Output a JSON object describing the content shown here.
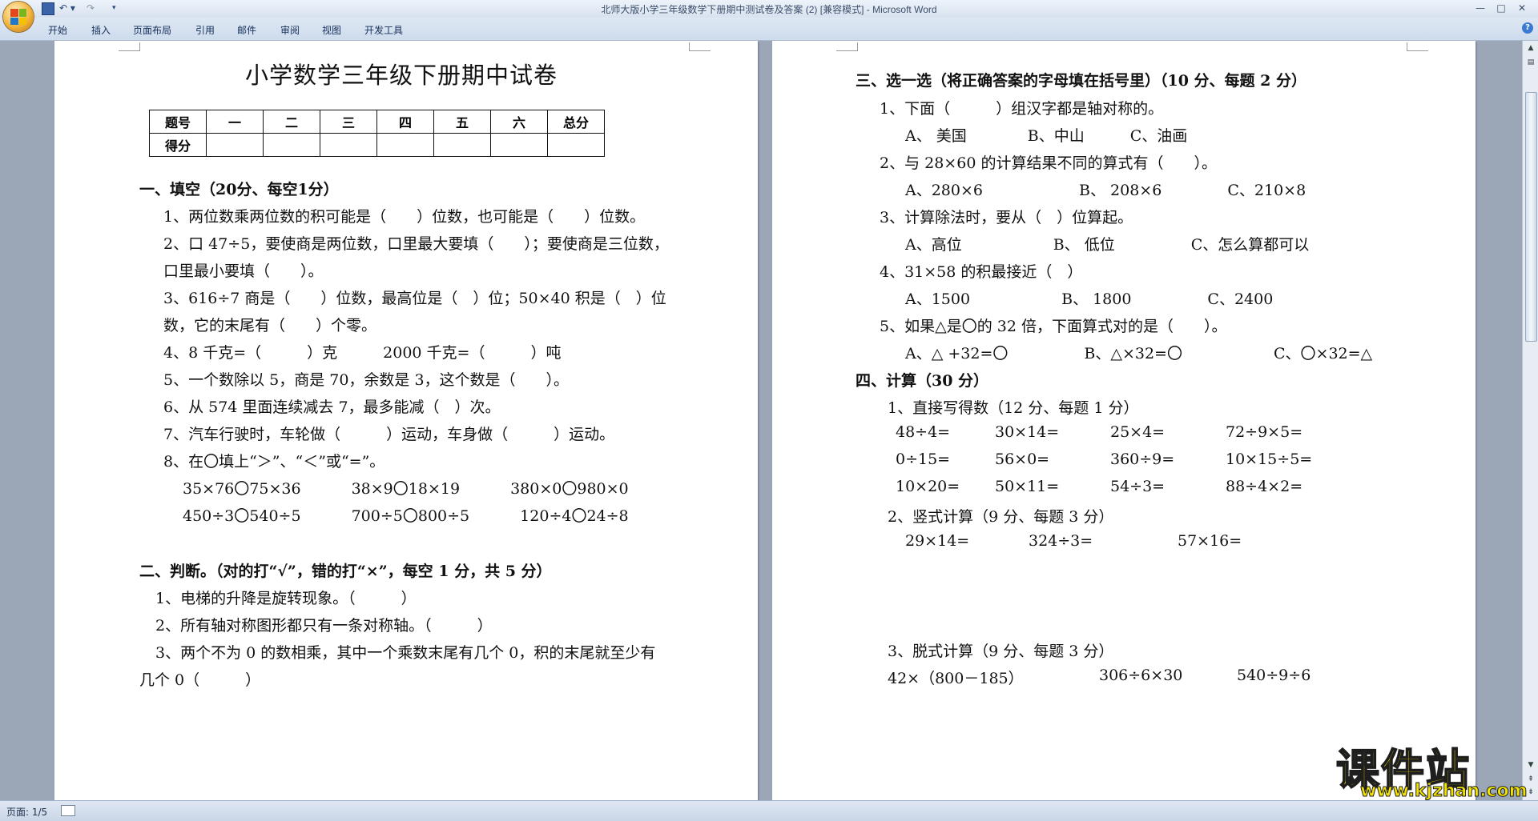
{
  "window": {
    "title": "北师大版小学三年级数学下册期中测试卷及答案 (2) [兼容模式] - Microsoft Word",
    "min": "—",
    "max": "□",
    "close": "✕"
  },
  "quick_access": {
    "undo": "↶ ▾",
    "redo": "↷",
    "more": "▾"
  },
  "ribbon_tabs": [
    "开始",
    "插入",
    "页面布局",
    "引用",
    "邮件",
    "审阅",
    "视图",
    "开发工具"
  ],
  "status": {
    "page": "页面: 1/5"
  },
  "watermark": {
    "main": "课件站",
    "url": "www.kjzhan.com"
  },
  "page1": {
    "title": "小学数学三年级下册期中试卷",
    "score_table": {
      "row1": [
        "题号",
        "一",
        "二",
        "三",
        "四",
        "五",
        "六",
        "总分"
      ],
      "row2": [
        "得分",
        "",
        "",
        "",
        "",
        "",
        "",
        ""
      ]
    },
    "lines": [
      "一、填空（20分、每空1分）",
      "1、两位数乘两位数的积可能是（　　）位数，也可能是（　　）位数。",
      "2、口 47÷5，要使商是两位数，口里最大要填（　　）；要使商是三位数，",
      "口里最小要填（　　）。",
      "3、616÷7 商是（　　）位数，最高位是（　）位；50×40 积是（　）位",
      "数，它的末尾有（　　）个零。",
      "4、8 千克=（　　　）克　　　2000 千克=（　　　）吨",
      "5、一个数除以 5，商是 70，余数是 3，这个数是（　　）。",
      "6、从 574 里面连续减去 7，最多能减（　）次。",
      "7、汽车行驶时，车轮做（　　　）运动，车身做（　　　）运动。",
      "8、在〇填上“＞”、“＜”或“=”。",
      "35×76〇75×36　　　 38×9〇18×19　　　 380×0〇980×0",
      "450÷3〇540÷5　　　 700÷5〇800÷5　　　 120÷4〇24÷8",
      "",
      "二、判断。（对的打“√”，错的打“×”，每空 1 分，共 5 分）",
      "1、电梯的升降是旋转现象。（　　　）",
      "2、所有轴对称图形都只有一条对称轴。（　　　）",
      "3、两个不为 0 的数相乘，其中一个乘数末尾有几个 0，积的末尾就至少有",
      "几个 0（　　　）"
    ]
  },
  "page2": {
    "lines": [
      "三、选一选（将正确答案的字母填在括号里）（10 分、每题 2 分）",
      "1、下面（　　　）组汉字都是轴对称的。",
      "A、 美国　　　　B、中山　　　C、油画",
      "2、与 28×60 的计算结果不同的算式有（　　）。",
      "A、280×6　　　　　　 B、 208×6　　　　 C、210×8",
      "3、计算除法时，要从（　）位算起。",
      "A、高位　　　　　　B、 低位　　　　　C、怎么算都可以",
      "4、31×58 的积最接近（　）",
      "A、1500　　　　　　B、 1800　　　　　C、2400",
      "5、如果△是〇的 32 倍，下面算式对的是（　　）。",
      "A、△ +32=〇　　　　　B、△×32=〇　　　　　　C、〇×32=△",
      "四、计算（30 分）",
      "1、直接写得数（12 分、每题 1 分）",
      "2、竖式计算（9 分、每题 3 分）",
      "3、脱式计算（9 分、每题 3 分）"
    ],
    "mental_math": [
      [
        "48÷4=",
        "30×14=",
        "25×4=",
        "72÷9×5="
      ],
      [
        "0÷15=",
        "56×0=",
        "360÷9=",
        "10×15÷5="
      ],
      [
        "10×20=",
        "50×11=",
        "54÷3=",
        "88÷4×2="
      ]
    ],
    "vertical_calc": [
      "29×14=",
      "324÷3=",
      "57×16="
    ],
    "step_calc_partial": [
      "42×（800－185）",
      "306÷6×30",
      "540÷9÷6"
    ]
  }
}
